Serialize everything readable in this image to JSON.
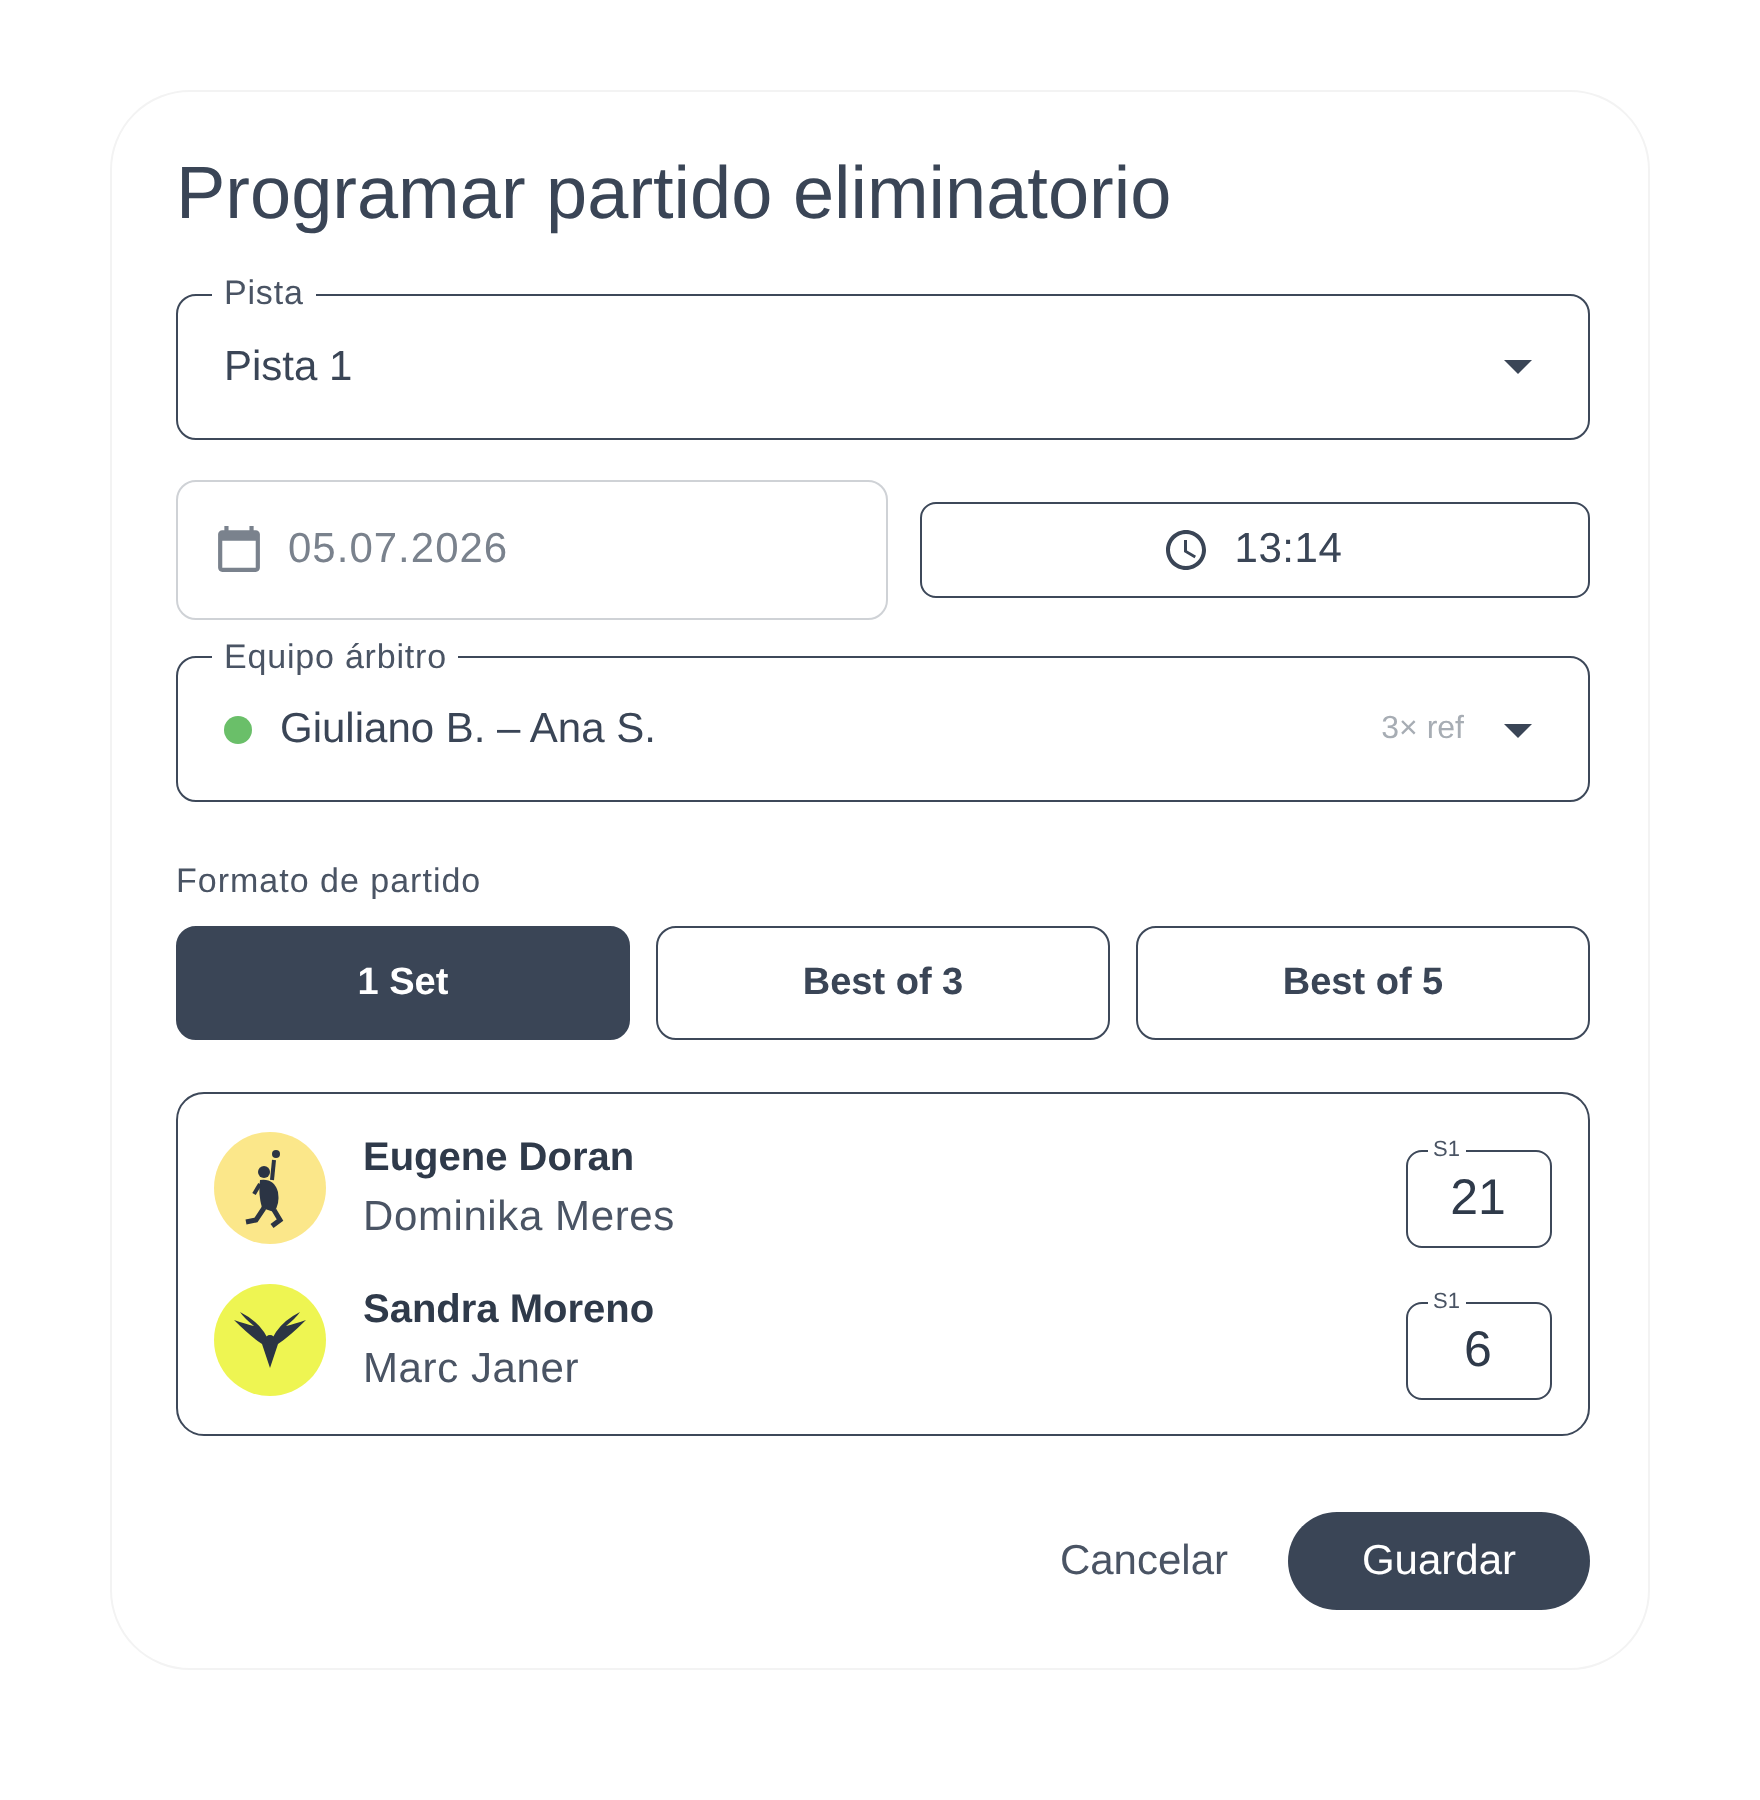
{
  "dialog": {
    "title": "Programar partido eliminatorio"
  },
  "court": {
    "label": "Pista",
    "value": "Pista 1"
  },
  "date": {
    "value": "05.07.2026",
    "disabled": true
  },
  "time": {
    "value": "13:14"
  },
  "referee": {
    "label": "Equipo árbitro",
    "value": "Giuliano B. – Ana S.",
    "color": "#6abf69",
    "meta": "3× ref"
  },
  "format": {
    "label": "Formato de partido",
    "options": [
      {
        "label": "1 Set",
        "selected": true
      },
      {
        "label": "Best of 3",
        "selected": false
      },
      {
        "label": "Best of 5",
        "selected": false
      }
    ]
  },
  "teams": [
    {
      "kind": "player",
      "color": "#fbe78a",
      "player_1": "Eugene Doran",
      "player_2": "Dominika Meres",
      "score_label": "S1",
      "score": "21"
    },
    {
      "kind": "wings",
      "color": "#eef552",
      "player_1": "Sandra Moreno",
      "player_2": "Marc Janer",
      "score_label": "S1",
      "score": "6"
    }
  ],
  "actions": [
    {
      "kind": "text",
      "label": "Cancelar"
    },
    {
      "kind": "filled",
      "label": "Guardar"
    }
  ]
}
